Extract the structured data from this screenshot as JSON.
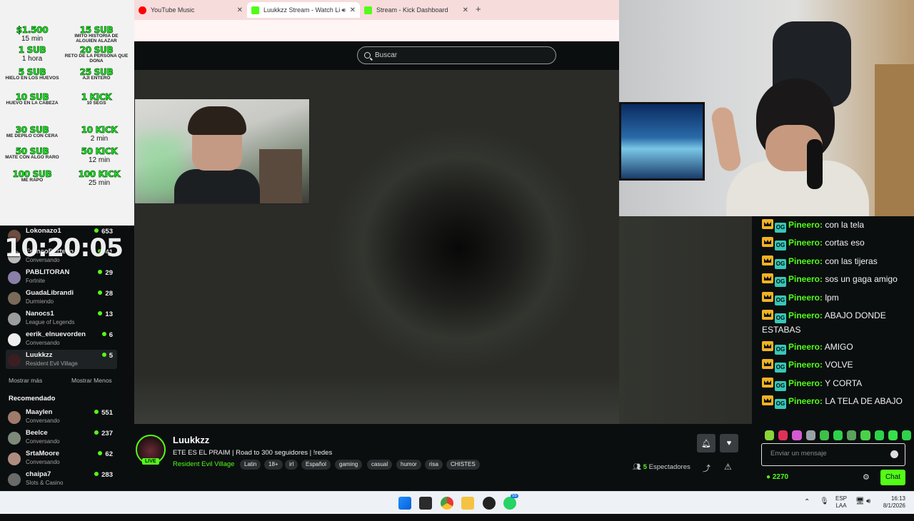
{
  "browser": {
    "tabs": [
      {
        "label": "YouTube Music",
        "color": "#ff0000"
      },
      {
        "label": "Luukkzz Stream - Watch Li",
        "color": "#53fc18"
      },
      {
        "label": "Stream - Kick Dashboard",
        "color": "#53fc18"
      }
    ],
    "new_tab": "+"
  },
  "header": {
    "search_placeholder": "Buscar"
  },
  "goals": [
    {
      "big": "$1.500",
      "mid": "15 min"
    },
    {
      "big": "15 SUB",
      "small": "IMITO HISTORIA DE ALGUIEN ALAZAR"
    },
    {
      "big": "1 SUB",
      "mid": "1 hora"
    },
    {
      "big": "20 SUB",
      "small": "RETO DE LA PERSONA QUE DONA"
    },
    {
      "big": "5 SUB",
      "small": "HIELO EN LOS HUEVOS"
    },
    {
      "big": "25 SUB",
      "small": "AJI ENTERO"
    },
    {
      "big": "10 SUB",
      "small": "HUEVO EN LA CABEZA"
    },
    {
      "big": "1 KICK",
      "small": "10 SEGS"
    },
    {
      "big": "30 SUB",
      "small": "ME DEPILO CON CERA"
    },
    {
      "big": "10 KICK",
      "mid": "2 min"
    },
    {
      "big": "50 SUB",
      "small": "MATE CON ALGO RARO"
    },
    {
      "big": "50 KICK",
      "mid": "12 min"
    },
    {
      "big": "100 SUB",
      "small": "ME RAPO"
    },
    {
      "big": "100 KICK",
      "mid": "25 min"
    }
  ],
  "timer": "10:20:05",
  "sidebar": {
    "following": [
      {
        "name": "Lokonazo1",
        "sub": "",
        "count": "653"
      },
      {
        "name": "FrancoBertello",
        "sub": "Conversando",
        "count": "41"
      },
      {
        "name": "PABLITORAN",
        "sub": "Fortnite",
        "count": "29"
      },
      {
        "name": "GuadaLibrandi",
        "sub": "Durmiendo",
        "count": "28"
      },
      {
        "name": "Nanocs1",
        "sub": "League of Legends",
        "count": "13"
      },
      {
        "name": "eerik_elnuevorden",
        "sub": "Conversando",
        "count": "6"
      },
      {
        "name": "Luukkzz",
        "sub": "Resident Evil Village",
        "count": "5"
      }
    ],
    "show_more": "Mostrar más",
    "show_less": "Mostrar Menos",
    "recommended_title": "Recomendado",
    "recommended": [
      {
        "name": "Maaylen",
        "sub": "Conversando",
        "count": "551"
      },
      {
        "name": "Beelce",
        "sub": "Conversando",
        "count": "237"
      },
      {
        "name": "SrtaMoore",
        "sub": "Conversando",
        "count": "62"
      },
      {
        "name": "chaipa7",
        "sub": "Slots & Casino",
        "count": "283"
      }
    ]
  },
  "stream": {
    "channel": "Luukkzz",
    "live": "LIVE",
    "title": "ETE ES EL PRAIM | Road to 300 seguidores | !redes",
    "category": "Resident Evil Village",
    "tags": [
      "Latin",
      "18+",
      "irl",
      "Español",
      "gaming",
      "casual",
      "humor",
      "risa",
      "CHISTES"
    ],
    "viewers_count": "5",
    "viewers_label": "Espectadores"
  },
  "chat": {
    "messages": [
      {
        "user": "Pineero",
        "text": "con la tela"
      },
      {
        "user": "Pineero",
        "text": "cortas eso"
      },
      {
        "user": "Pineero",
        "text": "con las tijeras"
      },
      {
        "user": "Pineero",
        "text": "sos un gaga amigo"
      },
      {
        "user": "Pineero",
        "text": "lpm"
      },
      {
        "user": "Pineero",
        "text": "ABAJO DONDE ESTABAS"
      },
      {
        "user": "Pineero",
        "text": "AMIGO"
      },
      {
        "user": "Pineero",
        "text": "VOLVE"
      },
      {
        "user": "Pineero",
        "text": "Y CORTA"
      },
      {
        "user": "Pineero",
        "text": "LA TELA DE ABAJO"
      }
    ],
    "input_placeholder": "Enviar un mensaje",
    "points": "2270",
    "send_label": "Chat"
  },
  "taskbar": {
    "lang": "ESP",
    "lang2": "LAA",
    "time": "16:13",
    "date": "8/1/2026",
    "whatsapp_badge": "55"
  }
}
